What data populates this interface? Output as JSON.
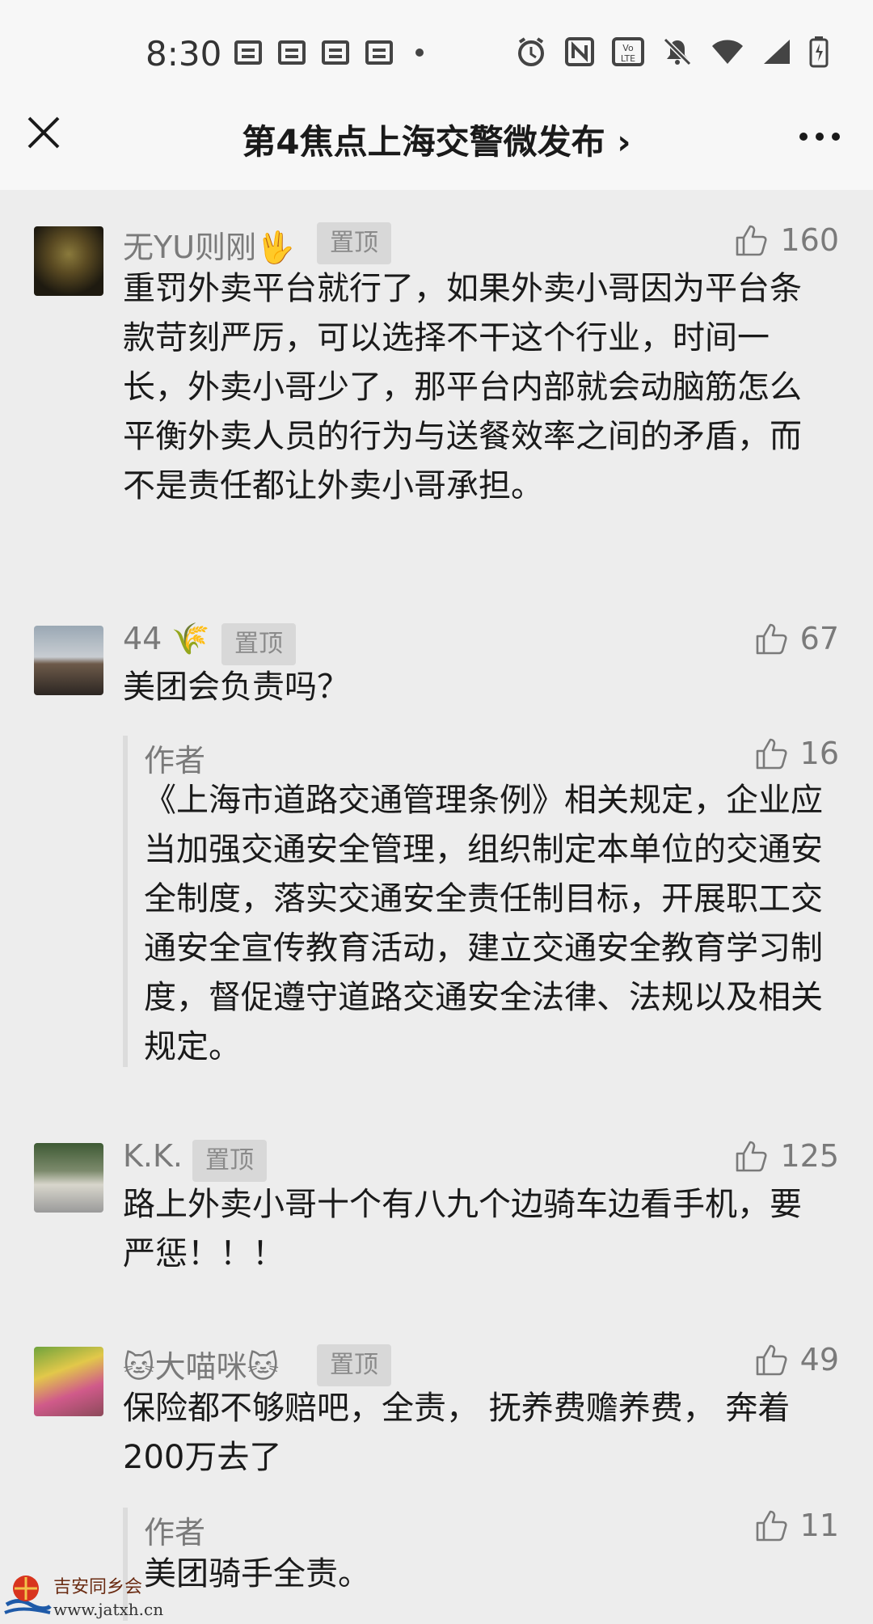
{
  "status_bar": {
    "time": "8:30"
  },
  "header": {
    "title": "第4焦点上海交警微发布 ›"
  },
  "comments": [
    {
      "user": "无YU则刚🖖",
      "pin_label": "置顶",
      "likes": "160",
      "text": "重罚外卖平台就行了，如果外卖小哥因为平台条款苛刻严厉，可以选择不干这个行业，时间一长，外卖小哥少了，那平台内部就会动脑筋怎么平衡外卖人员的行为与送餐效率之间的矛盾，而不是责任都让外卖小哥承担。"
    },
    {
      "user": "44 🌾",
      "pin_label": "置顶",
      "likes": "67",
      "text": "美团会负责吗？",
      "reply": {
        "author": "作者",
        "likes": "16",
        "text": "《上海市道路交通管理条例》相关规定，企业应当加强交通安全管理，组织制定本单位的交通安全制度，落实交通安全责任制目标，开展职工交通安全宣传教育活动，建立交通安全教育学习制度，督促遵守道路交通安全法律、法规以及相关规定。"
      }
    },
    {
      "user": "K.K.",
      "pin_label": "置顶",
      "likes": "125",
      "text": "路上外卖小哥十个有八九个边骑车边看手机，要严惩！！！"
    },
    {
      "user": "🐱大喵咪🐱",
      "pin_label": "置顶",
      "likes": "49",
      "text": "保险都不够赔吧，全责， 抚养费赡养费， 奔着200万去了",
      "reply": {
        "author": "作者",
        "likes": "11",
        "text": "美团骑手全责。"
      }
    }
  ],
  "watermark": {
    "line1": "吉安同乡会",
    "line2": "www.jatxh.cn"
  }
}
